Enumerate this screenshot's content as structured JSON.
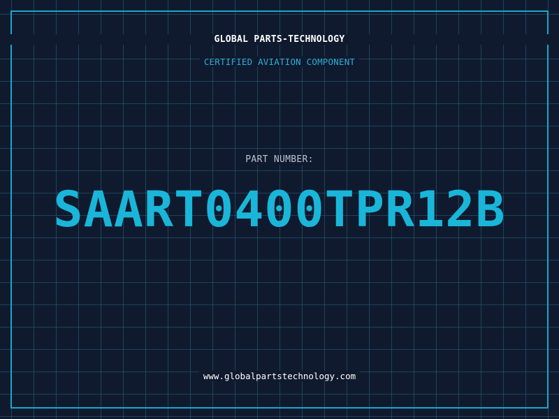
{
  "header": {
    "company": "GLOBAL PARTS-TECHNOLOGY",
    "subtitle": "CERTIFIED AVIATION COMPONENT"
  },
  "part": {
    "label": "PART NUMBER:",
    "number": "SAART0400TPR12B"
  },
  "footer": {
    "url": "www.globalpartstechnology.com"
  },
  "colors": {
    "background": "#101a2e",
    "accent": "#19b6d9",
    "grid": "#28788f",
    "frame": "#1aa7c9"
  }
}
